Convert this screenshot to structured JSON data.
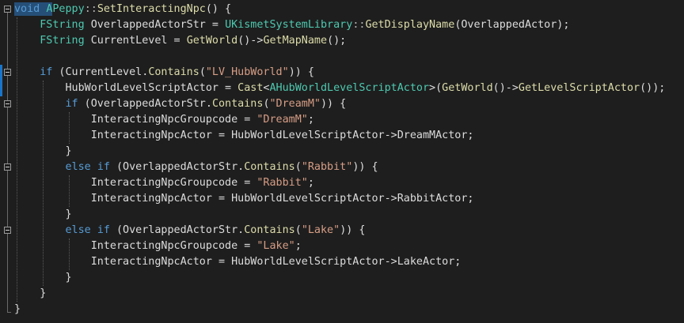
{
  "editor": {
    "language": "C++",
    "selected_token": "void",
    "lines": [
      [
        {
          "t": "void",
          "c": "kw"
        },
        {
          "t": " "
        },
        {
          "t": "APeppy",
          "c": "tp"
        },
        {
          "t": "::",
          "c": "op"
        },
        {
          "t": "SetInteractingNpc",
          "c": "fn"
        },
        {
          "t": "() {"
        }
      ],
      [
        {
          "t": "    "
        },
        {
          "t": "FString",
          "c": "tp"
        },
        {
          "t": " OverlappedActorStr = "
        },
        {
          "t": "UKismetSystemLibrary",
          "c": "tp"
        },
        {
          "t": "::",
          "c": "op"
        },
        {
          "t": "GetDisplayName",
          "c": "fn"
        },
        {
          "t": "(OverlappedActor);"
        }
      ],
      [
        {
          "t": "    "
        },
        {
          "t": "FString",
          "c": "tp"
        },
        {
          "t": " CurrentLevel = "
        },
        {
          "t": "GetWorld",
          "c": "fn"
        },
        {
          "t": "()->"
        },
        {
          "t": "GetMapName",
          "c": "fn"
        },
        {
          "t": "();"
        }
      ],
      [],
      [
        {
          "t": "    "
        },
        {
          "t": "if",
          "c": "kw"
        },
        {
          "t": " (CurrentLevel."
        },
        {
          "t": "Contains",
          "c": "fn"
        },
        {
          "t": "("
        },
        {
          "t": "\"LV_HubWorld\"",
          "c": "str"
        },
        {
          "t": ")) {"
        }
      ],
      [
        {
          "t": "        HubWorldLevelScriptActor = "
        },
        {
          "t": "Cast",
          "c": "fn"
        },
        {
          "t": "<"
        },
        {
          "t": "AHubWorldLevelScriptActor",
          "c": "tp"
        },
        {
          "t": ">("
        },
        {
          "t": "GetWorld",
          "c": "fn"
        },
        {
          "t": "()->"
        },
        {
          "t": "GetLevelScriptActor",
          "c": "fn"
        },
        {
          "t": "());"
        }
      ],
      [
        {
          "t": "        "
        },
        {
          "t": "if",
          "c": "kw"
        },
        {
          "t": " (OverlappedActorStr."
        },
        {
          "t": "Contains",
          "c": "fn"
        },
        {
          "t": "("
        },
        {
          "t": "\"DreamM\"",
          "c": "str"
        },
        {
          "t": ")) {"
        }
      ],
      [
        {
          "t": "            InteractingNpcGroupcode = "
        },
        {
          "t": "\"DreamM\"",
          "c": "str"
        },
        {
          "t": ";"
        }
      ],
      [
        {
          "t": "            InteractingNpcActor = HubWorldLevelScriptActor->DreamMActor;"
        }
      ],
      [
        {
          "t": "        }"
        }
      ],
      [
        {
          "t": "        "
        },
        {
          "t": "else",
          "c": "kw"
        },
        {
          "t": " "
        },
        {
          "t": "if",
          "c": "kw"
        },
        {
          "t": " (OverlappedActorStr."
        },
        {
          "t": "Contains",
          "c": "fn"
        },
        {
          "t": "("
        },
        {
          "t": "\"Rabbit\"",
          "c": "str"
        },
        {
          "t": ")) {"
        }
      ],
      [
        {
          "t": "            InteractingNpcGroupcode = "
        },
        {
          "t": "\"Rabbit\"",
          "c": "str"
        },
        {
          "t": ";"
        }
      ],
      [
        {
          "t": "            InteractingNpcActor = HubWorldLevelScriptActor->RabbitActor;"
        }
      ],
      [
        {
          "t": "        }"
        }
      ],
      [
        {
          "t": "        "
        },
        {
          "t": "else",
          "c": "kw"
        },
        {
          "t": " "
        },
        {
          "t": "if",
          "c": "kw"
        },
        {
          "t": " (OverlappedActorStr."
        },
        {
          "t": "Contains",
          "c": "fn"
        },
        {
          "t": "("
        },
        {
          "t": "\"Lake\"",
          "c": "str"
        },
        {
          "t": ")) {"
        }
      ],
      [
        {
          "t": "            InteractingNpcGroupcode = "
        },
        {
          "t": "\"Lake\"",
          "c": "str"
        },
        {
          "t": ";"
        }
      ],
      [
        {
          "t": "            InteractingNpcActor = HubWorldLevelScriptActor->LakeActor;"
        }
      ],
      [
        {
          "t": "        }"
        }
      ],
      [
        {
          "t": "    }"
        }
      ],
      [
        {
          "t": "}"
        }
      ]
    ],
    "fold_lines": [
      0,
      4,
      6,
      10,
      14
    ]
  }
}
